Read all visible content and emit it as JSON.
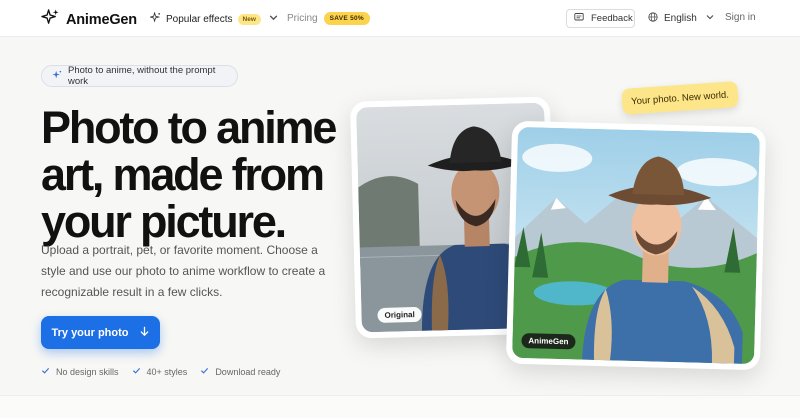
{
  "nav": {
    "brand": "AnimeGen",
    "effects_label": "Popular effects",
    "effects_badge": "New",
    "pricing_label": "Pricing",
    "pricing_badge": "SAVE 50%",
    "feedback_label": "Feedback",
    "language": "English",
    "signin": "Sign in"
  },
  "hero": {
    "pill": "Photo to anime, without the prompt work",
    "title_line1": "Photo to anime",
    "title_line2": "art, made from",
    "title_line3": "your picture.",
    "description": "Upload a portrait, pet, or favorite moment. Choose a style and use our photo to anime workflow to create a recognizable result in a few clicks.",
    "cta": "Try your photo",
    "features": [
      "No design skills",
      "40+ styles",
      "Download ready"
    ]
  },
  "preview": {
    "note": "Your photo. New world.",
    "original_tag": "Original",
    "anime_tag": "AnimeGen"
  },
  "colors": {
    "accent": "#1d6fe6",
    "badge_yellow": "#fcd34d",
    "note_yellow": "#fde68a"
  },
  "icons": [
    "sparkles-icon",
    "chevron-down-icon",
    "feedback-icon",
    "globe-icon",
    "arrow-down-icon",
    "check-icon"
  ]
}
